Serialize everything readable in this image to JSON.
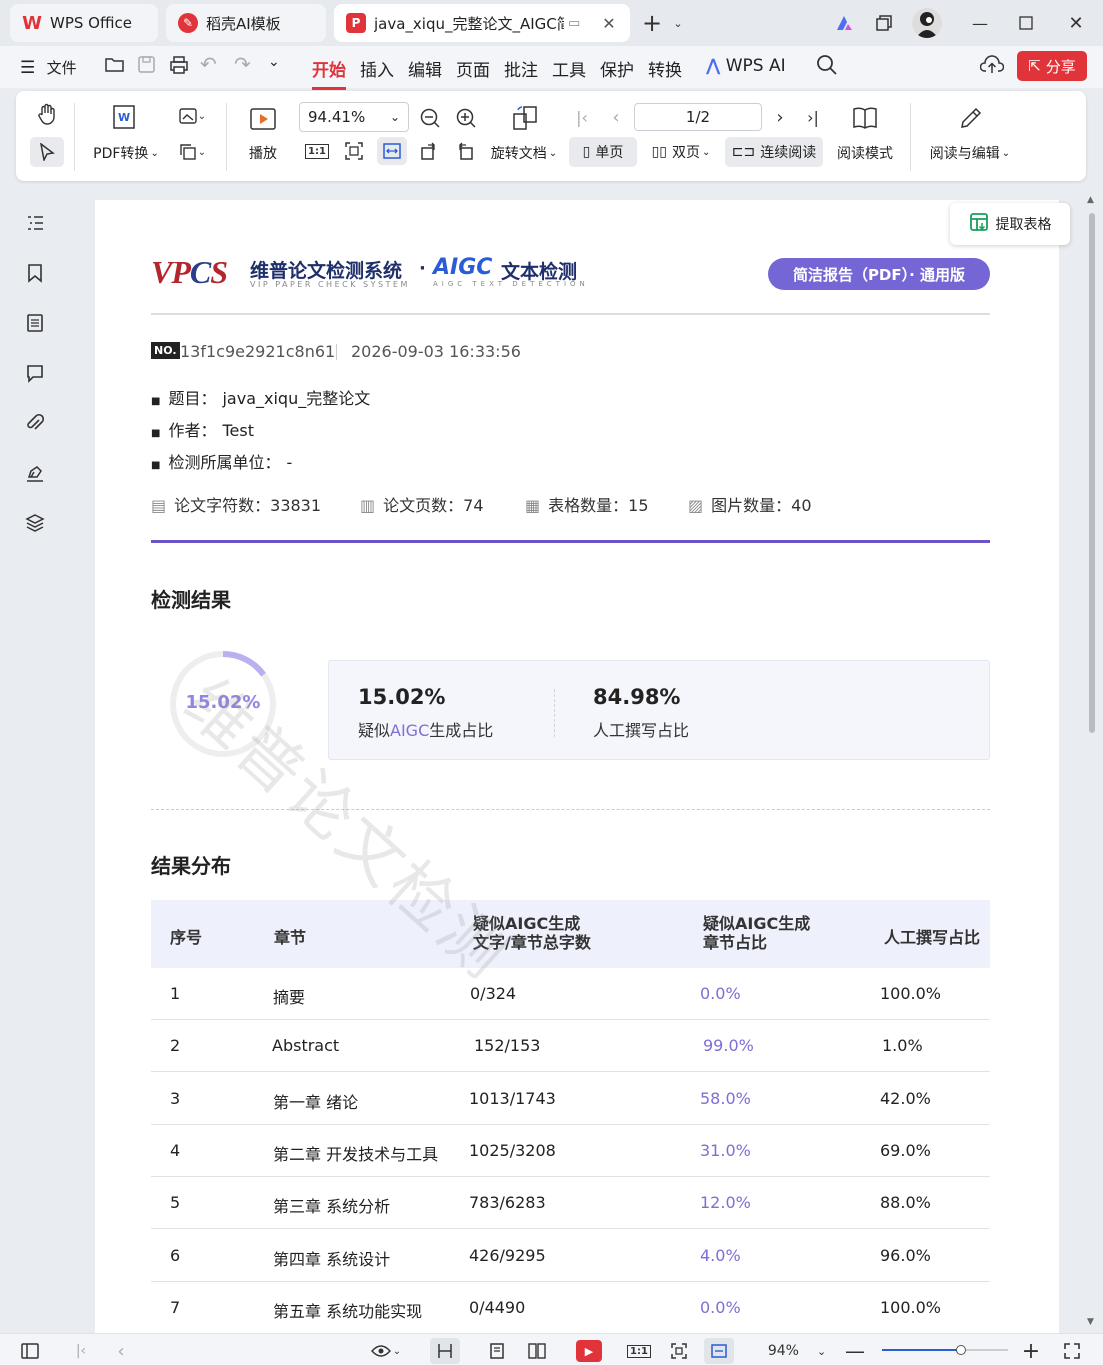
{
  "tabs": [
    {
      "label": "WPS Office",
      "icon": "wps-logo-icon"
    },
    {
      "label": "稻壳AI模板",
      "icon": "docer-icon"
    },
    {
      "label": "java_xiqu_完整论文_AIGC简",
      "icon": "pdf-icon"
    }
  ],
  "menu": {
    "file": "文件",
    "items": [
      "开始",
      "插入",
      "编辑",
      "页面",
      "批注",
      "工具",
      "保护",
      "转换"
    ],
    "wps_ai": "WPS AI",
    "share": "分享"
  },
  "ribbon": {
    "pdf_convert": "PDF转换",
    "play": "播放",
    "zoom_value": "94.41%",
    "rotate_doc": "旋转文档",
    "page_value": "1/2",
    "single_page": "单页",
    "double_page": "双页",
    "continuous": "连续阅读",
    "read_mode": "阅读模式",
    "read_edit": "阅读与编辑"
  },
  "extract_table": "提取表格",
  "report": {
    "logo_vpcs": "VPCS",
    "logo_title": "维普论文检测系统",
    "logo_sub": "VIP PAPER CHECK SYSTEM",
    "logo_aigc": "AIGC",
    "logo_aigc_title": "文本检测",
    "logo_aigc_sub": "AIGC TEXT DETECTION",
    "badge": "简洁报告（PDF）· 通用版",
    "no_label": "NO.",
    "report_no": "13f1c9e2921c8n61",
    "datetime": "2026-09-03 16:33:56",
    "title_label": "题目：",
    "title_value": "java_xiqu_完整论文",
    "author_label": "作者：",
    "author_value": "Test",
    "unit_label": "检测所属单位：",
    "unit_value": "-",
    "stats": [
      {
        "label": "论文字符数：",
        "value": "33831"
      },
      {
        "label": "论文页数：",
        "value": "74"
      },
      {
        "label": "表格数量：",
        "value": "15"
      },
      {
        "label": "图片数量：",
        "value": "40"
      }
    ],
    "watermark": "维普论文检测",
    "result_heading": "检测结果",
    "ring_label": "15.02%",
    "ring_fraction": 0.1502,
    "aigc_pct": "15.02%",
    "aigc_label_pre": "疑似",
    "aigc_label_mid": "AIGC",
    "aigc_label_post": "生成占比",
    "human_pct": "84.98%",
    "human_label": "人工撰写占比",
    "dist_heading": "结果分布",
    "table_headers": [
      "序号",
      "章节",
      "疑似AIGC生成\n文字/章节总字数",
      "疑似AIGC生成\n章节占比",
      "人工撰写占比"
    ],
    "rows": [
      {
        "no": "1",
        "chapter": "摘要",
        "ratio": "0/324",
        "aigc": "0.0%",
        "human": "100.0%"
      },
      {
        "no": "2",
        "chapter": "Abstract",
        "ratio": "152/153",
        "aigc": "99.0%",
        "human": "1.0%"
      },
      {
        "no": "3",
        "chapter": "第一章 绪论",
        "ratio": "1013/1743",
        "aigc": "58.0%",
        "human": "42.0%"
      },
      {
        "no": "4",
        "chapter": "第二章 开发技术与工具",
        "ratio": "1025/3208",
        "aigc": "31.0%",
        "human": "69.0%"
      },
      {
        "no": "5",
        "chapter": "第三章 系统分析",
        "ratio": "783/6283",
        "aigc": "12.0%",
        "human": "88.0%"
      },
      {
        "no": "6",
        "chapter": "第四章 系统设计",
        "ratio": "426/9295",
        "aigc": "4.0%",
        "human": "96.0%"
      },
      {
        "no": "7",
        "chapter": "第五章 系统功能实现",
        "ratio": "0/4490",
        "aigc": "0.0%",
        "human": "100.0%"
      }
    ]
  },
  "status": {
    "zoom": "94%"
  },
  "colors": {
    "accent_red": "#e0343a",
    "purple": "#6f5fd0",
    "light_purple": "#b8b0ef"
  }
}
